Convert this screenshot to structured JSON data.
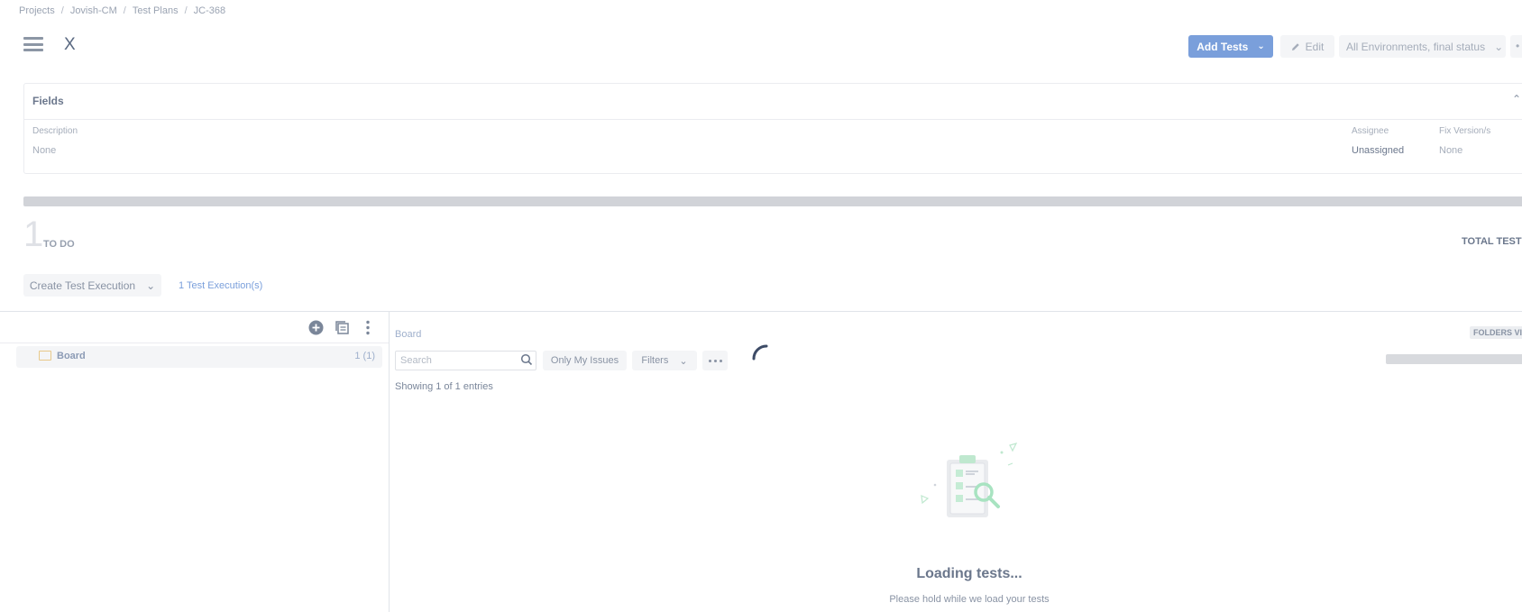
{
  "breadcrumb": {
    "items": [
      "Projects",
      "Jovish-CM",
      "Test Plans",
      "JC-368"
    ],
    "separator": "/"
  },
  "header": {
    "title": "X",
    "add_tests_label": "Add Tests",
    "edit_label": "Edit",
    "environment_label": "All Environments, final status",
    "more_label": "•"
  },
  "fields": {
    "title": "Fields",
    "description_label": "Description",
    "description_value": "None",
    "assignee_label": "Assignee",
    "assignee_value": "Unassigned",
    "fix_version_label": "Fix Version/s",
    "fix_version_value": "None"
  },
  "summary": {
    "count": "1",
    "count_label": "TO DO",
    "total_label": "TOTAL TESTS"
  },
  "actions": {
    "create_execution_label": "Create Test Execution",
    "executions_link": "1 Test Execution(s)"
  },
  "tree": {
    "items": [
      {
        "label": "Board",
        "count": "1 (1)"
      }
    ]
  },
  "tests_panel": {
    "title": "Board",
    "folders_view_label": "FOLDERS VIEW",
    "search_placeholder": "Search",
    "only_my_issues_label": "Only My Issues",
    "filters_label": "Filters",
    "showing_text": "Showing 1 of 1 entries",
    "loading_title": "Loading tests...",
    "loading_subtitle": "Please hold while we load your tests"
  },
  "colors": {
    "primary": "#7a9fdb",
    "progress_track": "#d1d3d8",
    "link": "#7a9fdb"
  },
  "icons": [
    "hamburger-icon",
    "pencil-icon",
    "chevron-down-icon",
    "chevron-up-icon",
    "plus-circle-icon",
    "copy-icon",
    "vertical-dots-icon",
    "folder-icon",
    "search-icon",
    "spinner-icon",
    "clipboard-illustration"
  ]
}
